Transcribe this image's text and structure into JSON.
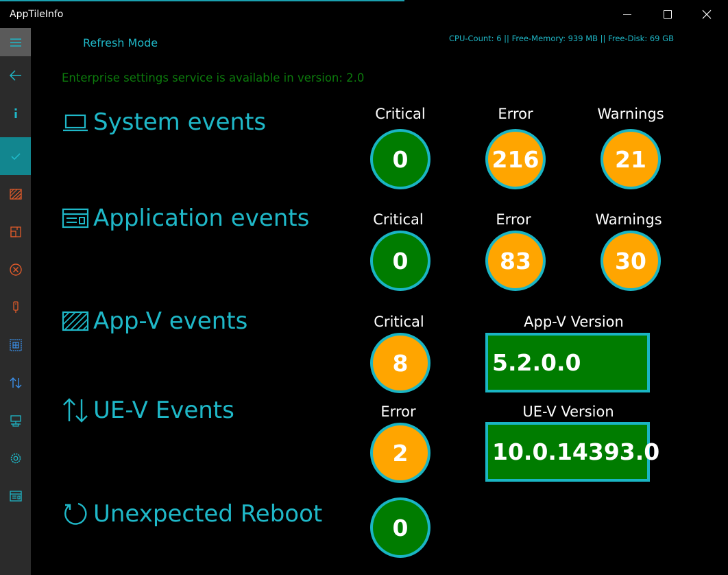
{
  "window": {
    "title": "AppTileInfo"
  },
  "header": {
    "refresh_label": "Refresh Mode",
    "sysinfo": "CPU-Count: 6 || Free-Memory: 939 MB || Free-Disk: 69 GB",
    "enterprise_status": "Enterprise settings service is available in version: 2.0"
  },
  "sections": {
    "system": {
      "title": "System events",
      "critical_label": "Critical",
      "critical": "0",
      "error_label": "Error",
      "error": "216",
      "warnings_label": "Warnings",
      "warnings": "21"
    },
    "application": {
      "title": "Application events",
      "critical_label": "Critical",
      "critical": "0",
      "error_label": "Error",
      "error": "83",
      "warnings_label": "Warnings",
      "warnings": "30"
    },
    "appv": {
      "title": "App-V events",
      "critical_label": "Critical",
      "critical": "8",
      "version_label": "App-V Version",
      "version": "5.2.0.0"
    },
    "uev": {
      "title": "UE-V Events",
      "error_label": "Error",
      "error": "2",
      "version_label": "UE-V Version",
      "version": "10.0.14393.0"
    },
    "reboot": {
      "title": "Unexpected Reboot",
      "count": "0"
    }
  },
  "colors": {
    "accent": "#1fb8c8",
    "ok": "#007c00",
    "warn": "#ffa500",
    "enterprise_text": "#0c7a0c"
  }
}
